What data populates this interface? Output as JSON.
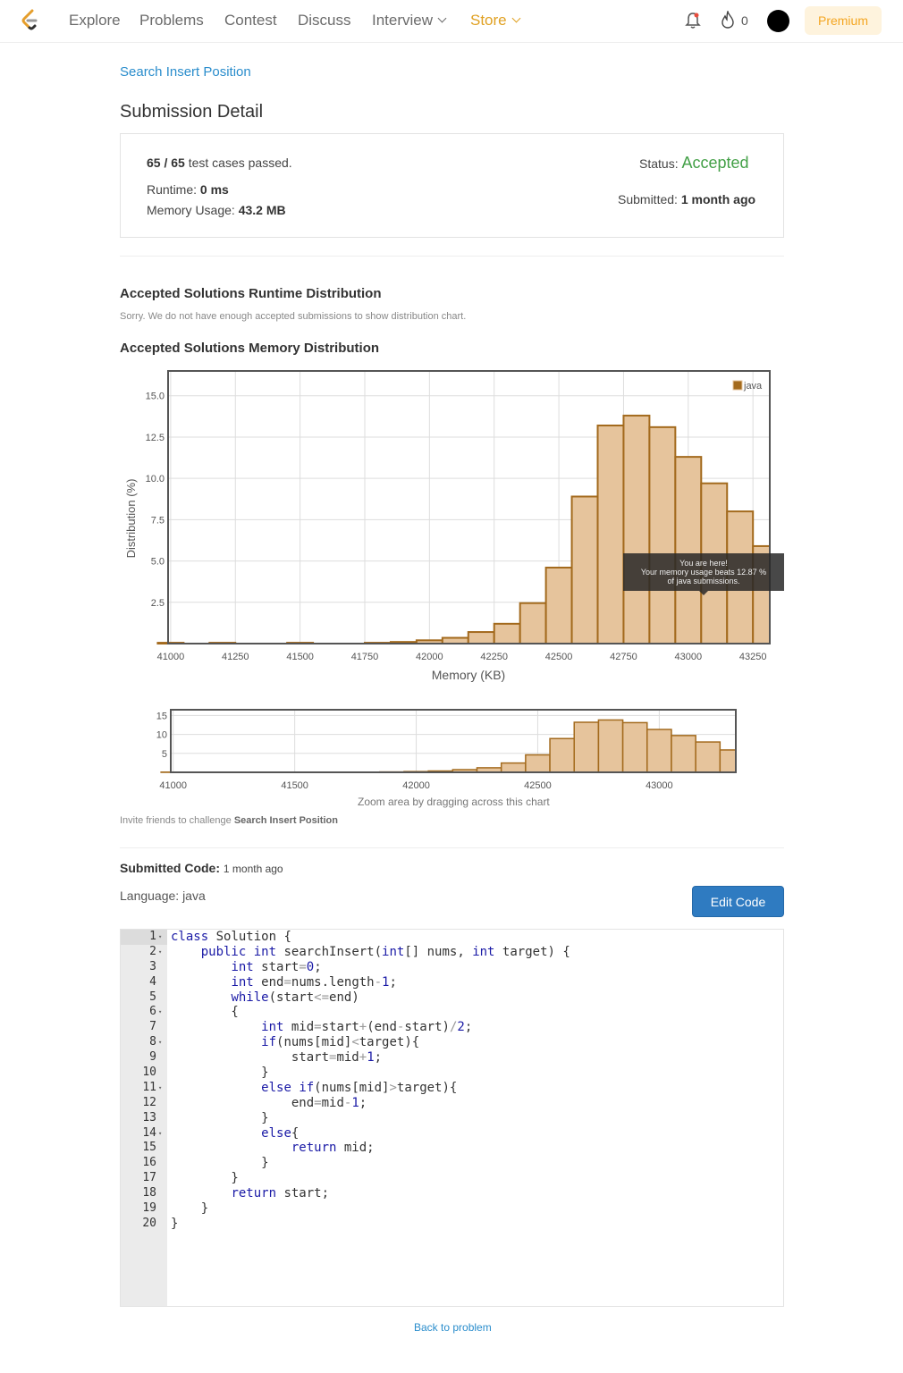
{
  "nav": {
    "items": [
      "Explore",
      "Problems",
      "Contest",
      "Discuss"
    ],
    "interview": "Interview",
    "store": "Store",
    "streak_count": "0",
    "premium": "Premium"
  },
  "breadcrumb": "Search Insert Position",
  "page_title": "Submission Detail",
  "summary": {
    "cases_passed": "65 / 65",
    "cases_suffix": " test cases passed.",
    "runtime_label": "Runtime: ",
    "runtime_value": "0 ms",
    "memory_label": "Memory Usage: ",
    "memory_value": "43.2 MB",
    "status_label": "Status: ",
    "status_value": "Accepted",
    "submitted_label": "Submitted: ",
    "submitted_value": "1 month ago"
  },
  "runtime_dist": {
    "title": "Accepted Solutions Runtime Distribution",
    "note": "Sorry. We do not have enough accepted submissions to show distribution chart."
  },
  "memory_dist": {
    "title": "Accepted Solutions Memory Distribution",
    "tooltip_line1": "You are here!",
    "tooltip_line2": "Your memory usage beats 12.87 %",
    "tooltip_line3": "of java submissions.",
    "zoom_hint": "Zoom area by dragging across this chart"
  },
  "invite": {
    "prefix": "Invite friends to challenge ",
    "problem": "Search Insert Position"
  },
  "chart_data": [
    {
      "type": "bar",
      "title": "",
      "xlabel": "Memory (KB)",
      "ylabel": "Distribution (%)",
      "legend": [
        "java"
      ],
      "legend_position": "top-right",
      "grid": true,
      "xlim": [
        40990,
        43315
      ],
      "ylim": [
        0,
        16.5
      ],
      "x_ticks": [
        41000,
        41250,
        41500,
        41750,
        42000,
        42250,
        42500,
        42750,
        43000,
        43250
      ],
      "y_ticks": [
        2.5,
        5.0,
        7.5,
        10.0,
        12.5,
        15.0
      ],
      "bin_width": 100,
      "series": [
        {
          "name": "java",
          "color": "#e6c49c",
          "edge_color": "#a36a1d",
          "x": [
            41000,
            41200,
            41500,
            41800,
            41900,
            42000,
            42100,
            42200,
            42300,
            42400,
            42500,
            42600,
            42700,
            42800,
            42900,
            43000,
            43100,
            43200,
            43300
          ],
          "values": [
            0.05,
            0.05,
            0.05,
            0.05,
            0.1,
            0.2,
            0.35,
            0.7,
            1.2,
            2.45,
            4.6,
            8.9,
            13.2,
            13.8,
            13.1,
            11.3,
            9.7,
            8.0,
            5.9
          ]
        }
      ]
    },
    {
      "type": "bar",
      "title": "",
      "xlabel": "",
      "ylabel": "",
      "grid": true,
      "xlim": [
        40990,
        43315
      ],
      "ylim": [
        0,
        16.5
      ],
      "x_ticks": [
        41000,
        41500,
        42000,
        42500,
        43000
      ],
      "y_ticks": [
        5,
        10,
        15
      ],
      "series": [
        {
          "name": "java",
          "x": [
            41000,
            41200,
            41500,
            41800,
            41900,
            42000,
            42100,
            42200,
            42300,
            42400,
            42500,
            42600,
            42700,
            42800,
            42900,
            43000,
            43100,
            43200,
            43300
          ],
          "values": [
            0.05,
            0.05,
            0.05,
            0.05,
            0.1,
            0.2,
            0.35,
            0.7,
            1.2,
            2.45,
            4.6,
            8.9,
            13.2,
            13.8,
            13.1,
            11.3,
            9.7,
            8.0,
            5.9
          ]
        }
      ]
    }
  ],
  "code_section": {
    "label": "Submitted Code:",
    "ago": "1 month ago",
    "language": "Language: java",
    "edit_button": "Edit Code"
  },
  "code_lines": [
    "class Solution {",
    "    public int searchInsert(int[] nums, int target) {",
    "        int start=0;",
    "        int end=nums.length-1;",
    "        while(start<=end)",
    "        {",
    "            int mid=start+(end-start)/2;",
    "            if(nums[mid]<target){",
    "                start=mid+1;",
    "            }",
    "            else if(nums[mid]>target){",
    "                end=mid-1;",
    "            }",
    "            else{",
    "                return mid;",
    "            }",
    "        }",
    "        return start;",
    "    }",
    "}"
  ],
  "fold_lines": [
    1,
    2,
    6,
    8,
    11,
    14
  ],
  "back_link": "Back to problem",
  "colors": {
    "accent": "#2a8dcc",
    "accepted": "#43a047",
    "store": "#e0a123",
    "bar_fill": "#e6c49c",
    "bar_edge": "#a36a1d"
  }
}
